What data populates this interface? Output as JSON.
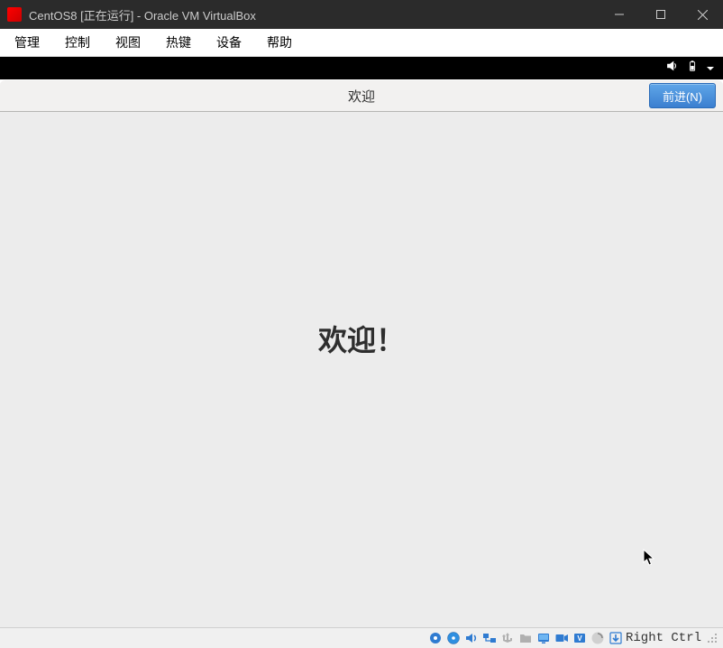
{
  "window": {
    "title": "CentOS8 [正在运行] - Oracle VM VirtualBox"
  },
  "menubar": {
    "items": [
      "管理",
      "控制",
      "视图",
      "热键",
      "设备",
      "帮助"
    ]
  },
  "gnome": {
    "header_title": "欢迎",
    "next_label": "前进(N)",
    "welcome_heading": "欢迎！"
  },
  "statusbar": {
    "host_key": "Right Ctrl"
  },
  "icons": {
    "app": "virtualbox-logo",
    "guest_top_indicators": [
      "volume-icon",
      "battery-icon",
      "dropdown-triangle-icon"
    ],
    "status_icons": [
      "harddisk-icon",
      "optical-disc-icon",
      "audio-icon",
      "network-icon",
      "usb-icon",
      "shared-folder-icon",
      "display-icon",
      "recording-icon",
      "video-capture-icon",
      "mouse-integration-icon",
      "host-key-arrow-icon"
    ]
  },
  "colors": {
    "titlebar_bg": "#2b2b2b",
    "guest_topbar_bg": "#000000",
    "content_bg": "#ececec",
    "next_btn_top": "#5fa6e8",
    "next_btn_bottom": "#3b7fd0",
    "icon_blue": "#2f7bd1"
  }
}
